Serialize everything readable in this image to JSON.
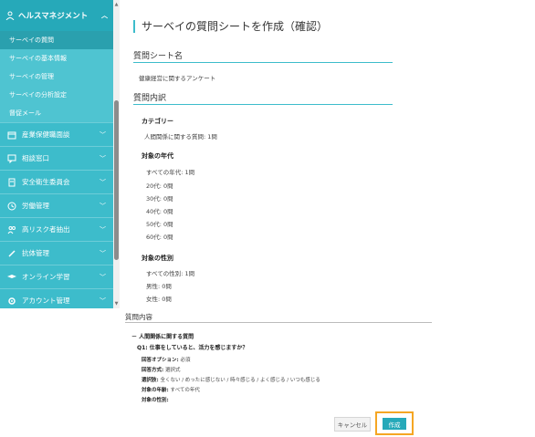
{
  "sidebar": {
    "header": "ヘルスマネジメント",
    "subitems": [
      "サーベイの質問",
      "サーベイの基本情報",
      "サーベイの管理",
      "サーベイの分析設定",
      "督促メール"
    ],
    "items": [
      "産業保健職面談",
      "相談窓口",
      "安全衛生委員会",
      "労働管理",
      "高リスク者抽出",
      "抗体管理",
      "オンライン学習",
      "アカウント管理"
    ]
  },
  "page": {
    "title": "サーベイの質問シートを作成（確認）",
    "sheet_name_heading": "質問シート名",
    "sheet_name": "健康経営に関するアンケート",
    "contents_heading": "質問内訳",
    "category_label": "カテゴリー",
    "category_value": "人間関係に関する質問: 1問",
    "age_label": "対象の年代",
    "ages": [
      "すべての年代: 1問",
      "20代: 0問",
      "30代: 0問",
      "40代: 0問",
      "50代: 0問",
      "60代: 0問"
    ],
    "gender_label": "対象の性別",
    "genders": [
      "すべての性別: 1問",
      "男性: 0問",
      "女性: 0問"
    ],
    "detail_heading": "質問内容",
    "group_title": "－ 人間関係に関する質問",
    "question": "Q1: 仕事をしていると、活力を感じますか？",
    "answer_option_label": "回答オプション:",
    "answer_option_value": "必須",
    "answer_method_label": "回答方式:",
    "answer_method_value": "選択式",
    "choices_label": "選択肢:",
    "choices_value": "全くない / めったに感じない / 時々感じる / よく感じる / いつも感じる",
    "target_age_label": "対象の年齢:",
    "target_age_value": "すべての年代",
    "target_gender_label": "対象の性別:"
  },
  "buttons": {
    "cancel": "キャンセル",
    "create": "作成"
  },
  "colors": {
    "accent": "#3dbccb",
    "dark_accent": "#26a9b9",
    "highlight": "#f5a623"
  }
}
